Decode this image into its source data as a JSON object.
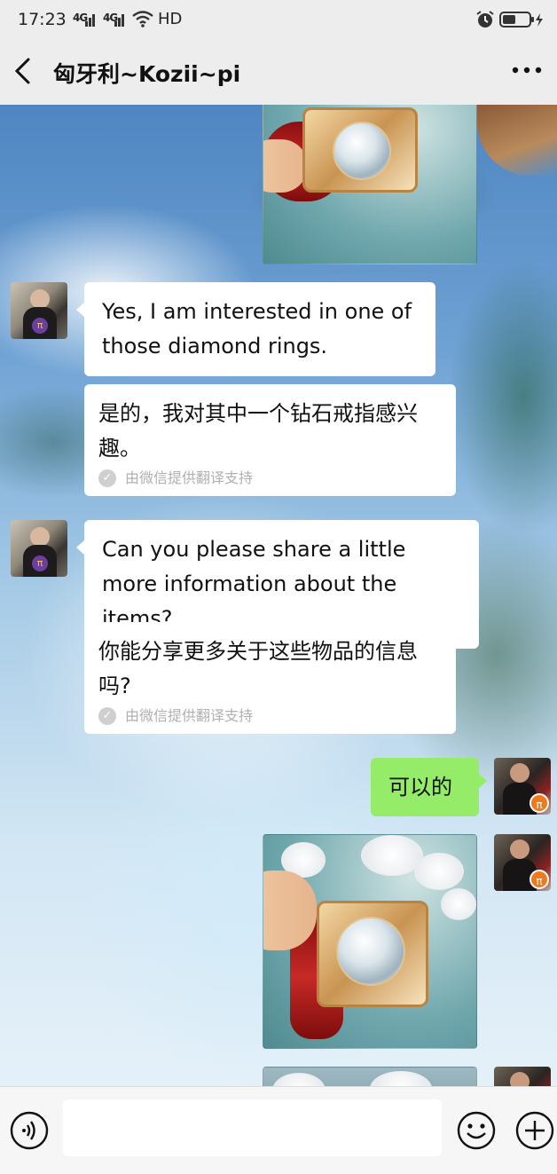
{
  "status_bar": {
    "time": "17:23",
    "network1": "4G",
    "network2": "4G",
    "hd": "HD",
    "icons": [
      "signal-icon",
      "wifi-icon",
      "alarm-icon",
      "battery-icon",
      "charging-icon"
    ]
  },
  "header": {
    "title": "匈牙利~Kozii~pi",
    "back_icon": "chevron-left-icon",
    "more_icon": "more-dots-icon"
  },
  "messages": [
    {
      "id": "m0",
      "type": "image",
      "sender": "me",
      "content": "diamond-ring-photo"
    },
    {
      "id": "m1",
      "type": "text",
      "sender": "contact",
      "text": "Yes, I am interested in one of those diamond rings."
    },
    {
      "id": "m2",
      "type": "translation",
      "sender": "contact",
      "text": "是的，我对其中一个钻石戒指感兴趣。",
      "credit": "由微信提供翻译支持"
    },
    {
      "id": "m3",
      "type": "text",
      "sender": "contact",
      "text": "Can you please share a little more information about the items?"
    },
    {
      "id": "m4",
      "type": "translation",
      "sender": "contact",
      "text": "你能分享更多关于这些物品的信息吗?",
      "credit": "由微信提供翻译支持"
    },
    {
      "id": "m5",
      "type": "text",
      "sender": "me",
      "text": "可以的"
    },
    {
      "id": "m6",
      "type": "image",
      "sender": "me",
      "content": "diamond-ring-photo"
    },
    {
      "id": "m7",
      "type": "image",
      "sender": "me",
      "content": "flower-photo-partial"
    }
  ],
  "input_bar": {
    "voice_icon": "voice-icon",
    "emoji_icon": "emoji-icon",
    "plus_icon": "plus-icon",
    "text_value": "",
    "placeholder": ""
  },
  "colors": {
    "header_bg": "#ededed",
    "bubble_incoming": "#ffffff",
    "bubble_outgoing": "#95ec69",
    "credit_text": "#b0b0b0"
  }
}
